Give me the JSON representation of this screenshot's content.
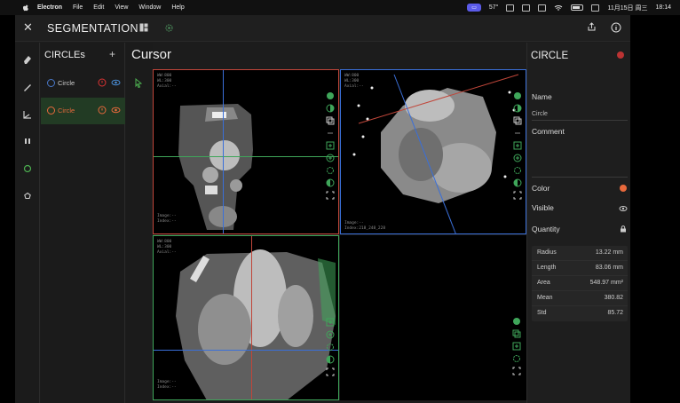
{
  "menubar": {
    "app_name": "Electron",
    "menus": [
      "File",
      "Edit",
      "View",
      "Window",
      "Help"
    ],
    "temperature": "57°",
    "datetime": "11月15日 周三",
    "time": "18:14"
  },
  "header": {
    "title": "SEGMENTATION"
  },
  "segmentations": {
    "title": "CIRCLEs",
    "add_label": "+",
    "items": [
      {
        "label": "Circle",
        "color": "#4a78c8"
      },
      {
        "label": "Circle",
        "color": "#e8693c"
      }
    ]
  },
  "main": {
    "title": "Cursor"
  },
  "viewports": [
    {
      "name": "top-left",
      "info_top": "WW:800\nWL:300\nAxial:--",
      "info_bottom": "Image:--\nIndex:--"
    },
    {
      "name": "top-right",
      "info_top": "WW:800\nWL:300\nAxial:--",
      "info_bottom": "Image:--\nIndex:218_248_228"
    },
    {
      "name": "bottom-left",
      "info_top": "WW:800\nWL:300\nAxial:--",
      "info_bottom": "Image:--\nIndex:--"
    }
  ],
  "properties": {
    "title": "CIRCLE",
    "name_label": "Name",
    "name_value": "Circle",
    "comment_label": "Comment",
    "color_label": "Color",
    "color_value": "#e8693c",
    "visible_label": "Visible",
    "quantity_label": "Quantity",
    "quantities": [
      {
        "key": "Radius",
        "value": "13.22 mm"
      },
      {
        "key": "Length",
        "value": "83.06 mm"
      },
      {
        "key": "Area",
        "value": "548.97 mm²"
      },
      {
        "key": "Mean",
        "value": "380.82"
      },
      {
        "key": "Std",
        "value": "85.72"
      }
    ]
  }
}
